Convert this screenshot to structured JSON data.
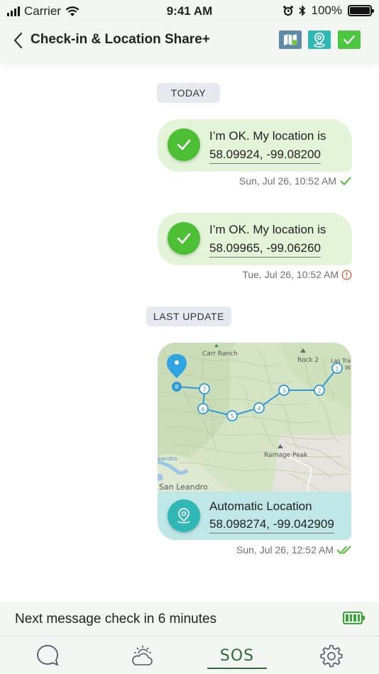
{
  "status_bar": {
    "carrier": "Carrier",
    "time": "9:41 AM",
    "battery_percent": "100%",
    "battery_level": 1.0
  },
  "header": {
    "title": "Check-in & Location Share+",
    "icons": [
      "map-icon",
      "location-pin-icon",
      "checkmark-icon"
    ],
    "colors": {
      "map": "#5d8aa8",
      "location": "#2fb8b5",
      "check": "#4dc742"
    }
  },
  "chat": {
    "today_label": "TODAY",
    "messages": [
      {
        "line1": "I’m OK. My location is",
        "coords": "58.09924, -99.08200",
        "timestamp": "Sun, Jul 26, 10:52 AM",
        "status": "sent"
      },
      {
        "line1": "I’m OK. My location is",
        "coords": "58.09965, -99.06260",
        "timestamp": "Tue, Jul 26, 10:52 AM",
        "status": "error"
      }
    ],
    "last_update_label": "LAST UPDATE",
    "location_update": {
      "map_labels": {
        "carr_ranch": "Carr Ranch",
        "rock2": "Rock 2",
        "las_tra": "Las Tra",
        "w": "W",
        "ramage_peak": "Ramage Peak",
        "eandro": "eandro",
        "san_leandro": "San Leandro"
      },
      "waypoints": [
        "1",
        "2",
        "3",
        "4",
        "5",
        "6",
        "7",
        "8"
      ],
      "title": "Automatic Location",
      "coords": "58.098274, -99.042909",
      "timestamp": "Sun, Jul 26, 12:52 AM",
      "status": "delivered"
    }
  },
  "footer": {
    "next_message": "Next message check in 6 minutes",
    "tabs": [
      {
        "name": "messages",
        "icon": "chat-bubble-icon"
      },
      {
        "name": "weather",
        "icon": "weather-cloud-sun-icon"
      },
      {
        "name": "sos",
        "label": "SOS",
        "active": true
      },
      {
        "name": "settings",
        "icon": "gear-icon"
      }
    ]
  }
}
